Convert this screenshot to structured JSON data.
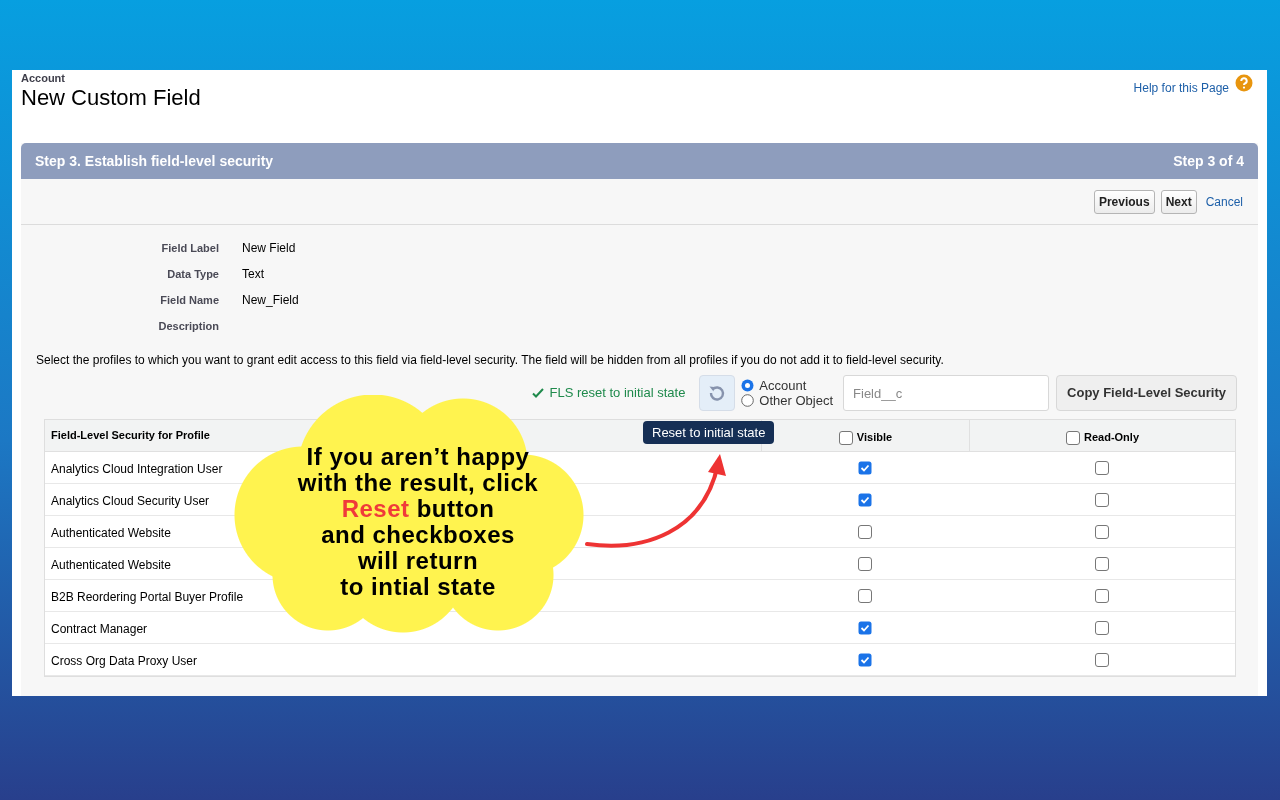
{
  "page": {
    "object": "Account",
    "title": "New Custom Field",
    "help_link": "Help for this Page"
  },
  "step": {
    "title": "Step 3. Establish field-level security",
    "counter": "Step 3 of 4"
  },
  "nav_buttons": [
    "Previous",
    "Next"
  ],
  "cancel_link": "Cancel",
  "details": [
    {
      "label": "Field Label",
      "value": "New Field"
    },
    {
      "label": "Data Type",
      "value": "Text"
    },
    {
      "label": "Field Name",
      "value": "New_Field"
    },
    {
      "label": "Description"
    }
  ],
  "instructions": "Select the profiles to which you want to grant edit access to this field via field-level security. The field will be hidden from all profiles if you do not add it to field-level security.",
  "toolbar": {
    "status": "FLS reset to initial state",
    "reset_tooltip": "Reset to initial state",
    "radios": [
      {
        "label": "Account",
        "selected": true
      },
      {
        "label": "Other Object",
        "selected": false
      }
    ],
    "field_placeholder": "Field__c",
    "copy_button": "Copy Field-Level Security"
  },
  "table": {
    "columns": [
      {
        "label": "Field-Level Security for Profile"
      },
      {
        "label": "Visible",
        "checked": false
      },
      {
        "label": "Read-Only",
        "checked": false
      }
    ],
    "rows": [
      {
        "profile": "Analytics Cloud Integration User",
        "visible": true,
        "read_only": false
      },
      {
        "profile": "Analytics Cloud Security User",
        "visible": true,
        "read_only": false
      },
      {
        "profile": "Authenticated Website",
        "visible": false,
        "read_only": false
      },
      {
        "profile": "Authenticated Website",
        "visible": false,
        "read_only": false
      },
      {
        "profile": "B2B Reordering Portal Buyer Profile",
        "visible": false,
        "read_only": false
      },
      {
        "profile": "Contract Manager",
        "visible": true,
        "read_only": false
      },
      {
        "profile": "Cross Org Data Proxy User",
        "visible": true,
        "read_only": false
      }
    ]
  },
  "callout": {
    "lines": [
      [
        {
          "text": "If you aren’t happy",
          "highlight": false
        }
      ],
      [
        {
          "text": "with the result, click",
          "highlight": false
        }
      ],
      [
        {
          "text": "Reset",
          "highlight": true
        },
        {
          "text": " button",
          "highlight": false
        }
      ],
      [
        {
          "text": "and checkboxes",
          "highlight": false
        }
      ],
      [
        {
          "text": "will return",
          "highlight": false
        }
      ],
      [
        {
          "text": "to intial state",
          "highlight": false
        }
      ]
    ]
  }
}
